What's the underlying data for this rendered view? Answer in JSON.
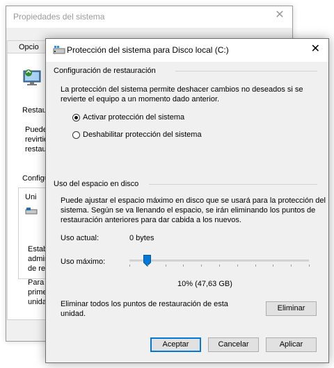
{
  "background_window": {
    "title": "Propiedades del sistema",
    "tab_label": "Opcio",
    "text_restau_heading": "Restau",
    "text_puede": "Puede",
    "text_revirtie": "revirtie",
    "text_restaur": "restaur",
    "text_configu": "Configu",
    "text_uni": "Uni",
    "text_estab": "Estab",
    "text_admin": "admin",
    "text_de_res": "de res",
    "text_para": "Para",
    "text_prime": "prime",
    "text_unida": "unida"
  },
  "dialog": {
    "title": "Protección del sistema para Disco local (C:)",
    "restore_section": {
      "heading": "Configuración de restauración",
      "description_line1": "La protección del sistema permite deshacer cambios no deseados si se",
      "description_line2": "revierte el equipo a un momento dado anterior.",
      "options": [
        {
          "label": "Activar protección del sistema",
          "selected": true
        },
        {
          "label": "Deshabilitar protección del sistema",
          "selected": false
        }
      ]
    },
    "disk_section": {
      "heading": "Uso del espacio en disco",
      "description_line1": "Puede ajustar el espacio máximo en disco que se usará para la protección del",
      "description_line2": "sistema. Según se va llenando el espacio, se irán eliminando los puntos de",
      "description_line3": "restauración anteriores para dar cabida a los nuevos.",
      "current_usage_label": "Uso actual:",
      "current_usage_value": "0 bytes",
      "max_usage_label": "Uso máximo:",
      "max_usage_fraction": 0.1,
      "max_usage_value": "10% (47,63 GB)",
      "delete_text_line1": "Eliminar todos los puntos de restauración de esta",
      "delete_text_line2": "unidad.",
      "delete_button": "Eliminar"
    },
    "buttons": {
      "ok": "Aceptar",
      "cancel": "Cancelar",
      "apply": "Aplicar"
    }
  },
  "colors": {
    "accent": "#0078d7",
    "window_bg": "#f0f0f0"
  }
}
